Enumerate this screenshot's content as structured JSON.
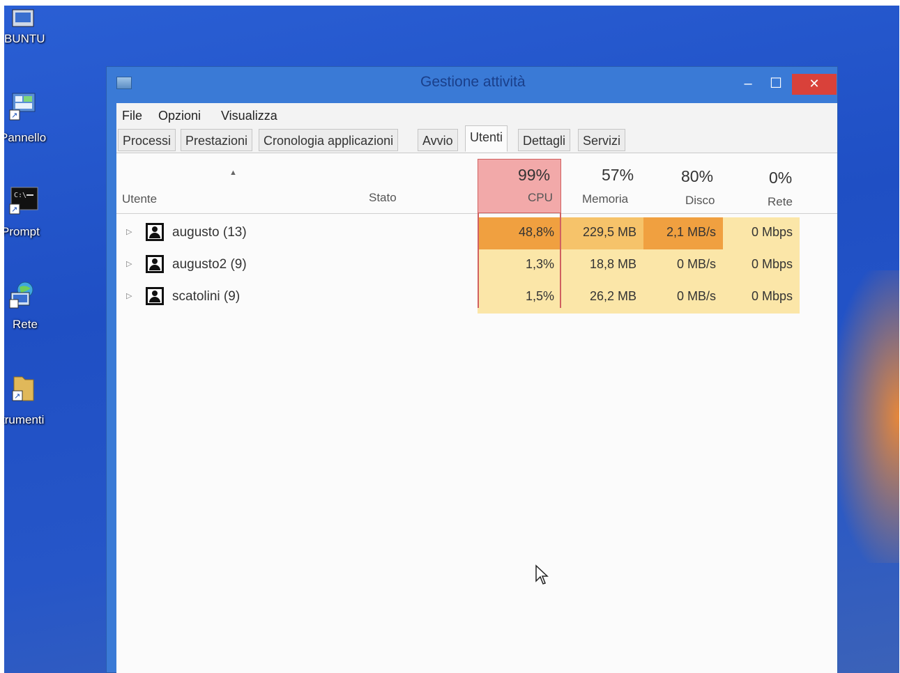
{
  "desktop": {
    "icons": [
      {
        "label": "BUNTU",
        "icon": "ubuntu-shortcut-icon"
      },
      {
        "label": "Pannello",
        "icon": "control-panel-icon"
      },
      {
        "label": "Prompt",
        "icon": "command-prompt-icon"
      },
      {
        "label": "Rete",
        "icon": "network-icon"
      },
      {
        "label": "trumenti",
        "icon": "tools-folder-icon"
      }
    ]
  },
  "window": {
    "title": "Gestione attività",
    "controls": {
      "minimize": "–",
      "maximize": "☐",
      "close": "✕"
    }
  },
  "menu": [
    "File",
    "Opzioni",
    "Visualizza"
  ],
  "tabs": [
    "Processi",
    "Prestazioni",
    "Cronologia applicazioni",
    "Avvio",
    "Utenti",
    "Dettagli",
    "Servizi"
  ],
  "active_tab": "Utenti",
  "columns": {
    "user": "Utente",
    "status": "Stato",
    "cpu": {
      "pct": "99%",
      "label": "CPU"
    },
    "memory": {
      "pct": "57%",
      "label": "Memoria"
    },
    "disk": {
      "pct": "80%",
      "label": "Disco"
    },
    "network": {
      "pct": "0%",
      "label": "Rete"
    }
  },
  "rows": [
    {
      "name": "augusto (13)",
      "cpu": "48,8%",
      "memory": "229,5 MB",
      "disk": "2,1 MB/s",
      "network": "0 Mbps"
    },
    {
      "name": "augusto2 (9)",
      "cpu": "1,3%",
      "memory": "18,8 MB",
      "disk": "0 MB/s",
      "network": "0 Mbps"
    },
    {
      "name": "scatolini (9)",
      "cpu": "1,5%",
      "memory": "26,2 MB",
      "disk": "0 MB/s",
      "network": "0 Mbps"
    }
  ],
  "colors": {
    "desktop": "#2656c8",
    "cpu_header": "#f2a9a9",
    "heat_high": "#f0a040",
    "heat_mid": "#f6c36a",
    "heat_low": "#fbe6a8",
    "close_button": "#d9413a"
  }
}
